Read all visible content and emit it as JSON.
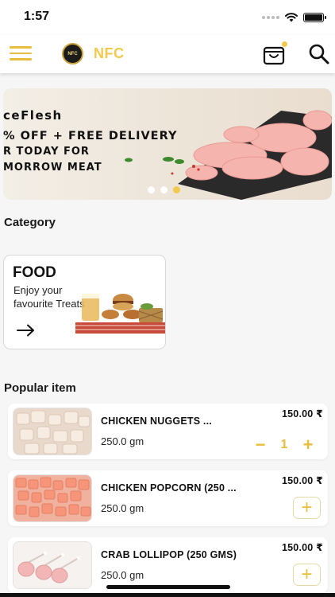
{
  "status_bar": {
    "time": "1:57"
  },
  "header": {
    "brand": "NFC",
    "logo_text": "NFC",
    "menu_icon": "hamburger-menu-icon",
    "cart_icon": "shopping-bag-icon",
    "search_icon": "search-icon"
  },
  "banner": {
    "line1": "ceFlesh",
    "line2": "% OFF + FREE DELIVERY",
    "line3": "R TODAY FOR",
    "line4": "MORROW MEAT",
    "slide_count": 3,
    "active_slide": 3
  },
  "category_section": {
    "title": "Category",
    "cards": [
      {
        "title": "FOOD",
        "description": "Enjoy your favourite Treats",
        "arrow_icon": "arrow-right-icon"
      }
    ]
  },
  "popular_section": {
    "title": "Popular item",
    "items": [
      {
        "name": "CHICKEN NUGGETS ...",
        "weight": "250.0 gm",
        "price": "150.00 ₹",
        "quantity": "1",
        "in_cart": true
      },
      {
        "name": "CHICKEN POPCORN (250 ...",
        "weight": "250.0 gm",
        "price": "150.00 ₹",
        "in_cart": false
      },
      {
        "name": "CRAB LOLLIPOP (250 GMS)",
        "weight": "250.0 gm",
        "price": "150.00 ₹",
        "in_cart": false
      }
    ],
    "minus_symbol": "−",
    "plus_symbol": "+"
  },
  "colors": {
    "accent": "#f2c94c",
    "accent_dark": "#e8bd3d",
    "background": "#f6f6f6"
  }
}
